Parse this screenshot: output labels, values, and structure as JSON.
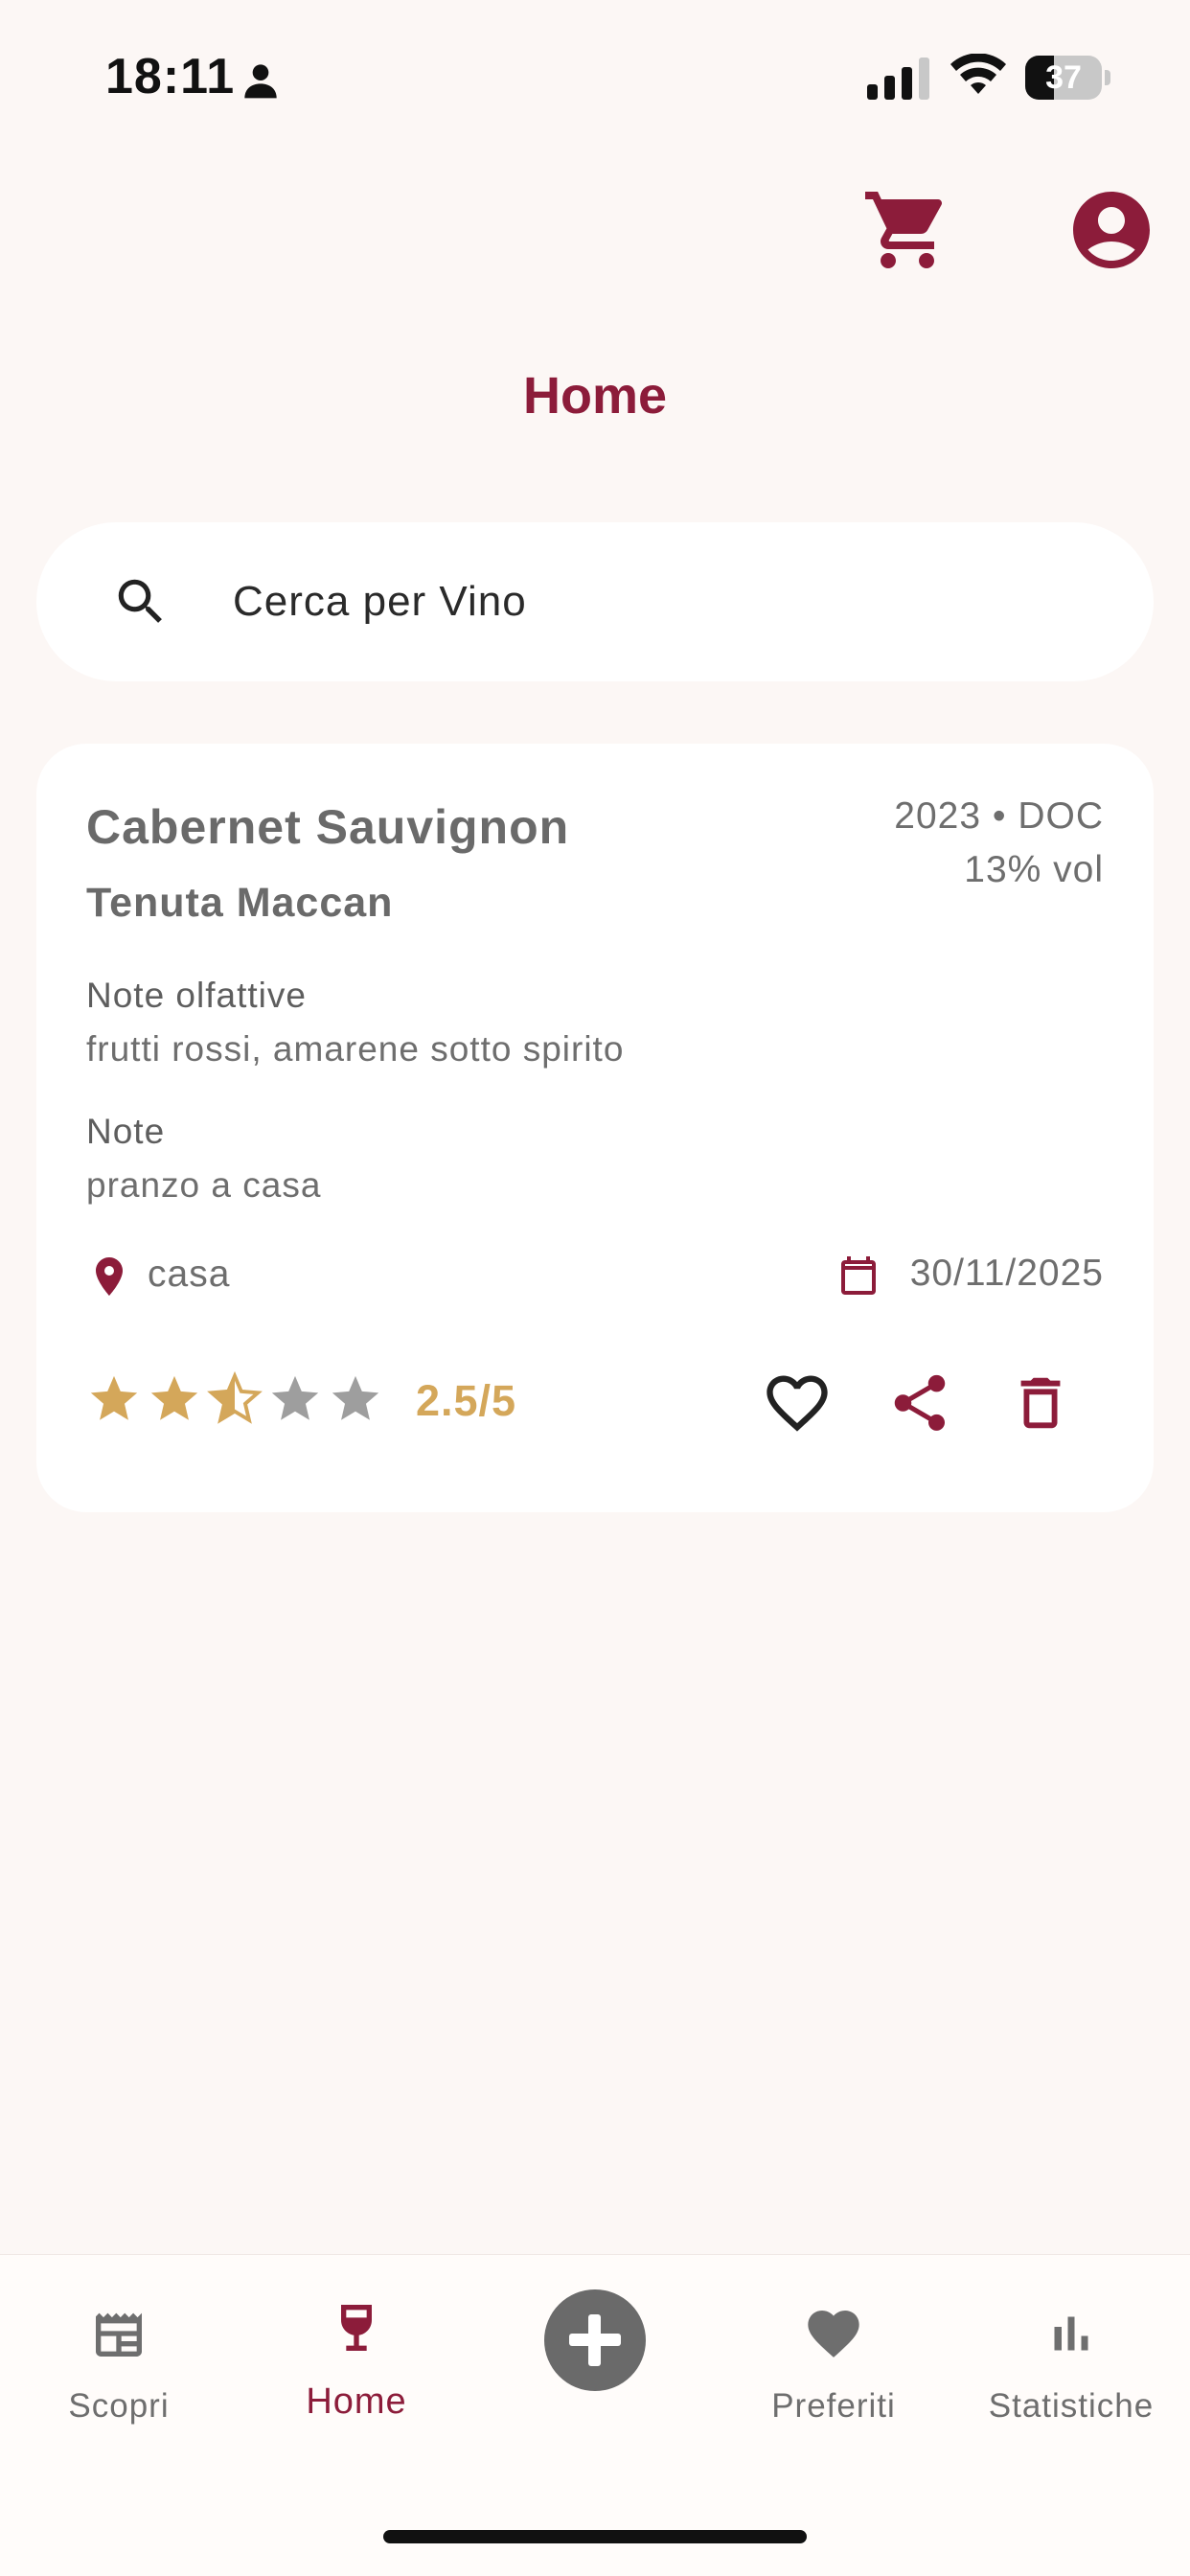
{
  "status_bar": {
    "time": "18:11",
    "battery": "37",
    "battery_level": 0.37,
    "icons": [
      "person-icon",
      "signal-icon",
      "wifi-icon",
      "battery-icon"
    ]
  },
  "header": {
    "title": "Home",
    "icons": [
      "cart-icon",
      "profile-icon"
    ]
  },
  "search": {
    "placeholder": "Cerca per Vino",
    "icon": "search-icon"
  },
  "wine_card": {
    "name": "Cabernet Sauvignon",
    "producer": "Tenuta Maccan",
    "vintage_denomination": "2023 • DOC",
    "abv": "13% vol",
    "olfactory_label": "Note olfattive",
    "olfactory_value": "frutti rossi, amarene sotto spirito",
    "notes_label": "Note",
    "notes_value": "pranzo a casa",
    "location": "casa",
    "date": "30/11/2025",
    "rating_value": 2.5,
    "rating_max": 5,
    "rating_text": "2.5/5",
    "actions": [
      "heart-outline-icon",
      "share-icon",
      "trash-icon"
    ]
  },
  "bottom_nav": {
    "items": [
      {
        "label": "Scopri",
        "icon": "newspaper-icon",
        "active": false
      },
      {
        "label": "Home",
        "icon": "wine-glass-icon",
        "active": true
      },
      {
        "label": "",
        "icon": "add-circle-icon",
        "active": false
      },
      {
        "label": "Preferiti",
        "icon": "heart-icon",
        "active": false
      },
      {
        "label": "Statistiche",
        "icon": "bar-chart-icon",
        "active": false
      }
    ]
  },
  "colors": {
    "accent": "#8C1C3A",
    "background": "#FCF7F5",
    "card": "#FFFFFF",
    "star_filled": "#D4A75A",
    "star_empty": "#9E9E9E",
    "text_muted": "#6E6E6E"
  }
}
